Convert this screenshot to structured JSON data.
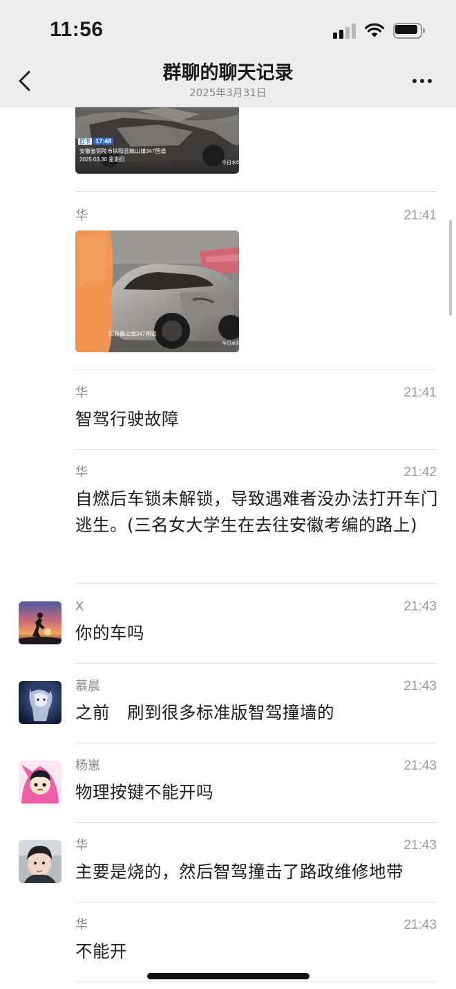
{
  "status_bar": {
    "time": "11:56"
  },
  "header": {
    "title": "群聊的聊天记录",
    "subtitle": "2025年3月31日"
  },
  "messages": [
    {
      "type": "image",
      "watermark": {
        "tag": "打卡",
        "time": "17:48",
        "location": "安徽省铜陵市枞阳县藕山镇347国道",
        "date": "2025.03.30 星期日",
        "mark": "今日水印"
      }
    },
    {
      "sender": "华",
      "time": "21:41",
      "type": "image",
      "watermark": {
        "location": "阳县藕山镇347国道",
        "mark": "今日水印"
      }
    },
    {
      "sender": "华",
      "time": "21:41",
      "text": "智驾行驶故障"
    },
    {
      "sender": "华",
      "time": "21:42",
      "text": "自燃后车锁未解锁，导致遇难者没办法打开车门逃生。(三名女大学生在去往安徽考编的路上)"
    },
    {
      "sender": "X",
      "time": "21:43",
      "text": "你的车吗"
    },
    {
      "sender": "慕晨",
      "time": "21:43",
      "text": "之前　刷到很多标准版智驾撞墙的"
    },
    {
      "sender": "杨崽",
      "time": "21:43",
      "text": "物理按键不能开吗"
    },
    {
      "sender": "华",
      "time": "21:43",
      "text": "主要是烧的，然后智驾撞击了路政维修地带"
    },
    {
      "sender": "华",
      "time": "21:43",
      "text": "不能开"
    }
  ]
}
